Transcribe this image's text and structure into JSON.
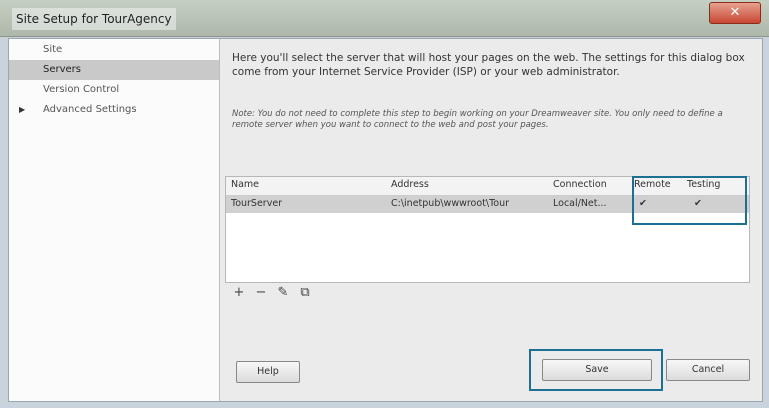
{
  "window": {
    "title": "Site Setup for TourAgency",
    "close_glyph": "✕"
  },
  "sidebar": {
    "items": [
      {
        "label": "Site",
        "selected": false,
        "expandable": false
      },
      {
        "label": "Servers",
        "selected": true,
        "expandable": false
      },
      {
        "label": "Version Control",
        "selected": false,
        "expandable": false
      },
      {
        "label": "Advanced Settings",
        "selected": false,
        "expandable": true
      }
    ],
    "expand_glyph": "▶"
  },
  "main": {
    "intro": "Here you'll select the server that will host your pages on the web. The settings for this dialog box come from your Internet Service Provider (ISP) or your web administrator.",
    "note": "Note: You do not need to complete this step to begin working on your Dreamweaver site. You only need to define a remote server when you want to connect to the web and post your pages."
  },
  "servers_table": {
    "headers": {
      "name": "Name",
      "address": "Address",
      "connection": "Connection",
      "remote": "Remote",
      "testing": "Testing"
    },
    "rows": [
      {
        "name": "TourServer",
        "address": "C:\\inetpub\\wwwroot\\Tour",
        "connection": "Local/Net...",
        "remote": "✔",
        "testing": "✔"
      }
    ]
  },
  "toolbar": {
    "add": "+",
    "remove": "−",
    "edit": "✎",
    "duplicate": "⧉"
  },
  "buttons": {
    "help": "Help",
    "save": "Save",
    "cancel": "Cancel"
  },
  "colors": {
    "highlight": "#1d6f93",
    "selected_row": "#c9c9c9",
    "close_button": "#c74732"
  }
}
